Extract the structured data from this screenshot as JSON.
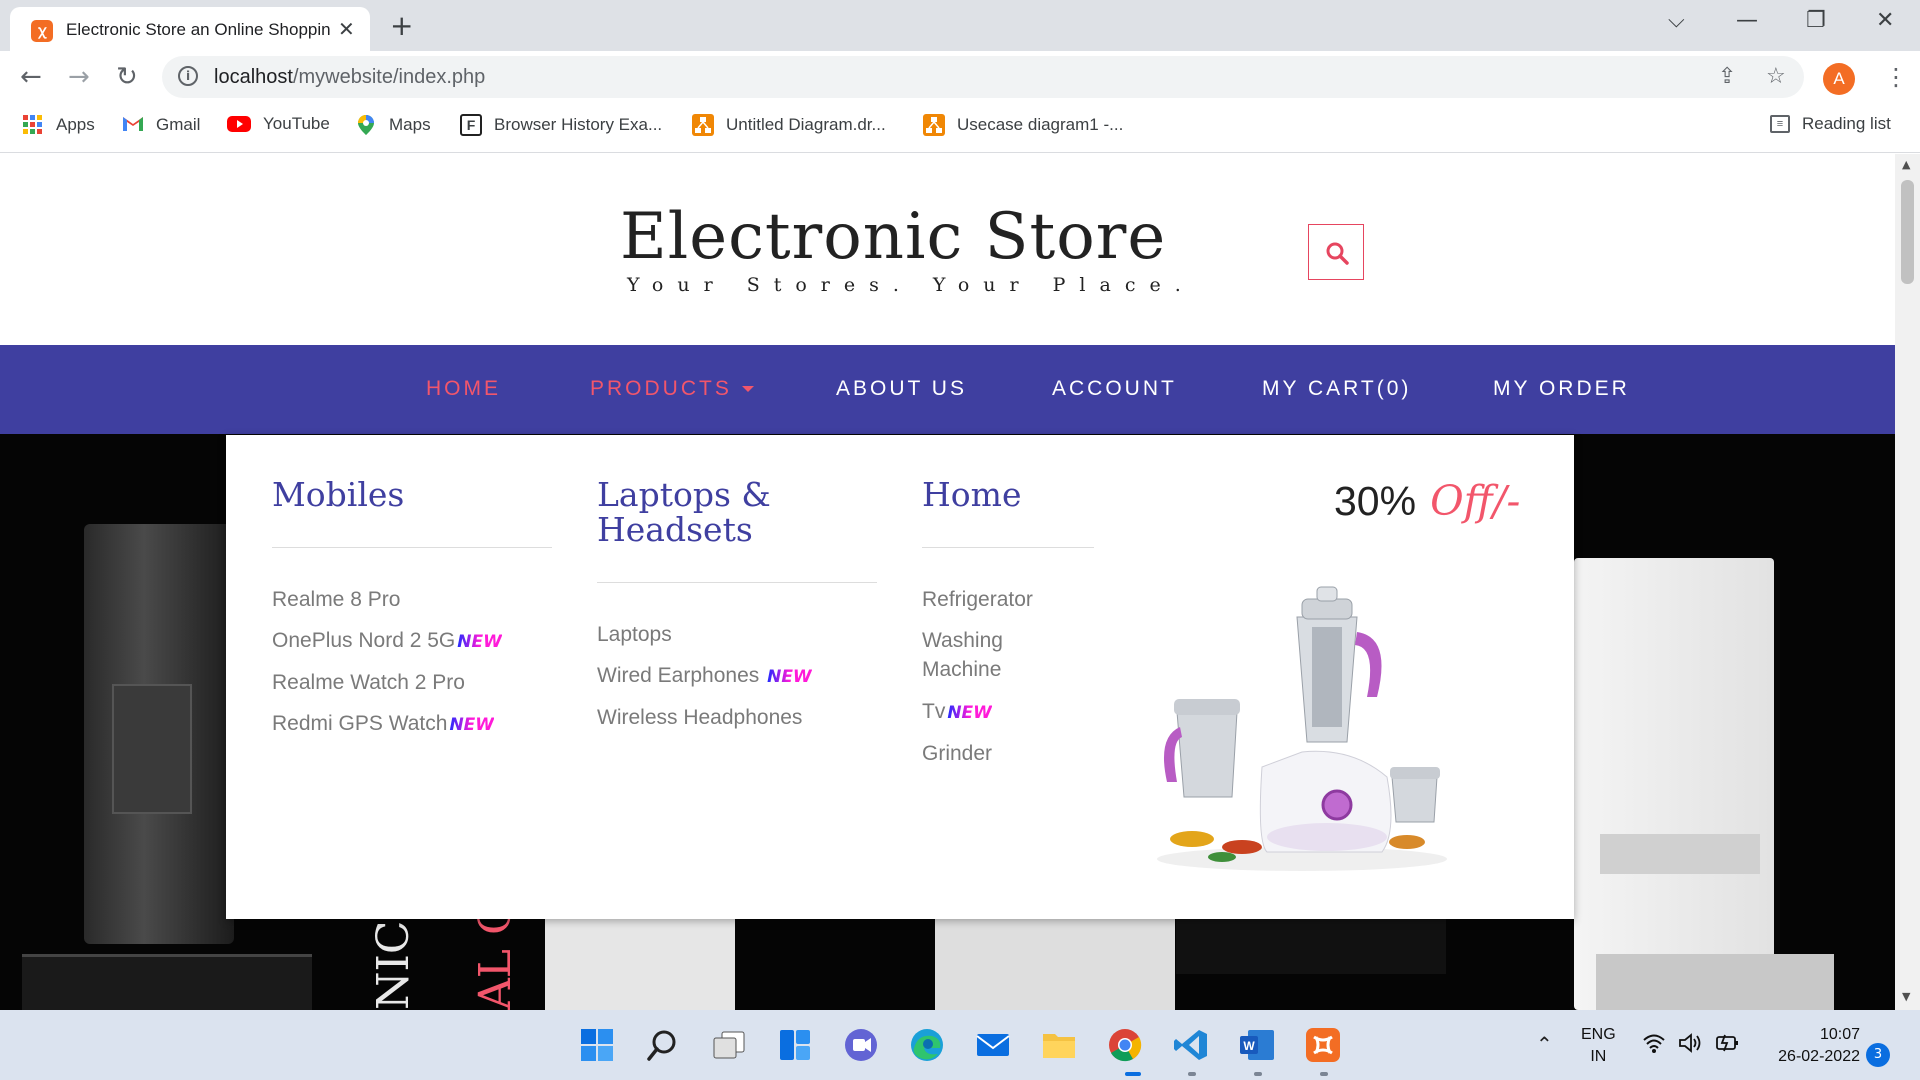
{
  "browser": {
    "tab_title": "Electronic Store an Online Shopping",
    "favicon_text": "ꭓ",
    "url_host": "localhost",
    "url_path": "/mywebsite/index.php",
    "profile_initial": "A",
    "bookmarks": [
      {
        "label": "Apps",
        "icon": "apps-grid-icon"
      },
      {
        "label": "Gmail",
        "icon": "gmail-icon"
      },
      {
        "label": "YouTube",
        "icon": "youtube-icon"
      },
      {
        "label": "Maps",
        "icon": "maps-pin-icon"
      },
      {
        "label": "Browser History Exa...",
        "icon": "f-square-icon"
      },
      {
        "label": "Untitled Diagram.dr...",
        "icon": "drawio-icon"
      },
      {
        "label": "Usecase diagram1 -...",
        "icon": "drawio-icon"
      }
    ],
    "reading_list": "Reading list"
  },
  "site": {
    "title": "Electronic Store",
    "tagline": "Your Stores. Your Place.",
    "accent": "#f2566b",
    "nav_color": "#3f3fa0"
  },
  "nav": {
    "items": [
      "HOME",
      "PRODUCTS",
      "ABOUT US",
      "ACCOUNT",
      "MY CART(0)",
      "MY ORDER"
    ]
  },
  "megamenu": {
    "columns": [
      {
        "heading_lines": [
          "Mobiles"
        ],
        "links": [
          {
            "text": "Realme 8 Pro",
            "new": ""
          },
          {
            "text": "OnePlus Nord 2 5G",
            "new": "NEW"
          },
          {
            "text": "Realme Watch 2 Pro",
            "new": ""
          },
          {
            "text": "Redmi GPS Watch",
            "new": "NEW"
          }
        ]
      },
      {
        "heading_lines": [
          "Laptops &",
          "Headsets"
        ],
        "links": [
          {
            "text": "Laptops",
            "new": ""
          },
          {
            "text": "Wired Earphones ",
            "new": "NEW"
          },
          {
            "text": "Wireless Headphones",
            "new": ""
          }
        ]
      },
      {
        "heading_lines": [
          "Home"
        ],
        "links": [
          {
            "text": "Refrigerator",
            "new": ""
          },
          {
            "text": "Washing",
            "new": ""
          },
          {
            "text": "Machine",
            "new": ""
          },
          {
            "text": "Tv",
            "new": "NEW"
          },
          {
            "text": "Grinder",
            "new": ""
          }
        ]
      }
    ],
    "offer_percent": "30%",
    "offer_text": "Off/-",
    "offer_image": "mixer-grinder-product-image"
  },
  "hero": {
    "vertical_text_1": "NIC S",
    "vertical_text_2": "AL O"
  },
  "taskbar": {
    "lang_1": "ENG",
    "lang_2": "IN",
    "time": "10:07",
    "date": "26-02-2022",
    "notifications": "3",
    "apps": [
      "windows-start-icon",
      "search-icon",
      "task-view-icon",
      "widgets-icon",
      "teams-chat-icon",
      "edge-icon",
      "mail-icon",
      "file-explorer-icon",
      "chrome-icon",
      "vscode-icon",
      "word-icon",
      "xampp-icon"
    ]
  }
}
